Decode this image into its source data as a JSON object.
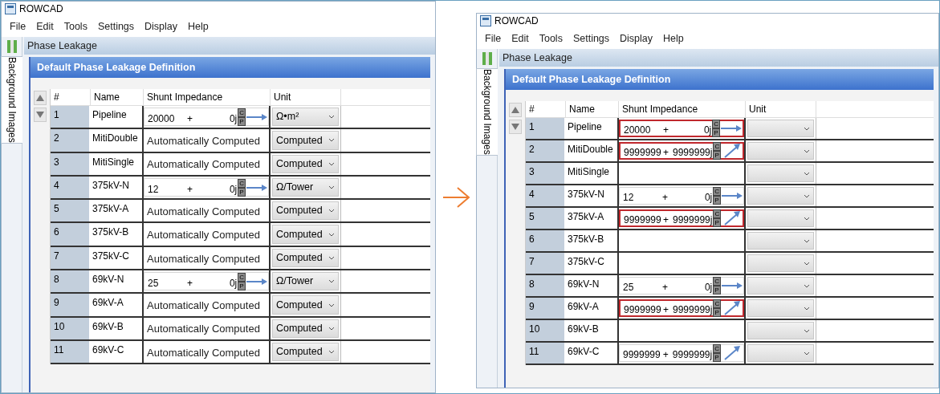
{
  "panels": [
    {
      "window": {
        "title": "ROWCAD"
      },
      "menu": [
        "File",
        "Edit",
        "Tools",
        "Settings",
        "Display",
        "Help"
      ],
      "side_tab": "Background Images",
      "panel_title": "Phase Leakage",
      "dialog_title": "Default Phase Leakage Definition",
      "table": {
        "columns": [
          "#",
          "Name",
          "Shunt Impedance",
          "Unit"
        ],
        "rows": [
          {
            "number": "1",
            "name": "Pipeline",
            "impedance": {
              "kind": "complex",
              "real": "20000",
              "sign": "+",
              "imag": "0j",
              "toggle": [
                "C",
                "P"
              ],
              "arrow": {
                "kind": "flat"
              },
              "error": false
            },
            "unit": "Ω•m²"
          },
          {
            "number": "2",
            "name": "MitiDouble",
            "impedance": {
              "kind": "computed",
              "text": "Automatically Computed"
            },
            "unit": "Computed"
          },
          {
            "number": "3",
            "name": "MitiSingle",
            "impedance": {
              "kind": "computed",
              "text": "Automatically Computed"
            },
            "unit": "Computed"
          },
          {
            "number": "4",
            "name": "375kV-N",
            "impedance": {
              "kind": "complex",
              "real": "12",
              "sign": "+",
              "imag": "0j",
              "toggle": [
                "C",
                "P"
              ],
              "arrow": {
                "kind": "flat"
              },
              "error": false
            },
            "unit": "Ω/Tower"
          },
          {
            "number": "5",
            "name": "375kV-A",
            "impedance": {
              "kind": "computed",
              "text": "Automatically Computed"
            },
            "unit": "Computed"
          },
          {
            "number": "6",
            "name": "375kV-B",
            "impedance": {
              "kind": "computed",
              "text": "Automatically Computed"
            },
            "unit": "Computed"
          },
          {
            "number": "7",
            "name": "375kV-C",
            "impedance": {
              "kind": "computed",
              "text": "Automatically Computed"
            },
            "unit": "Computed"
          },
          {
            "number": "8",
            "name": "69kV-N",
            "impedance": {
              "kind": "complex",
              "real": "25",
              "sign": "+",
              "imag": "0j",
              "toggle": [
                "C",
                "P"
              ],
              "arrow": {
                "kind": "flat"
              },
              "error": false
            },
            "unit": "Ω/Tower"
          },
          {
            "number": "9",
            "name": "69kV-A",
            "impedance": {
              "kind": "computed",
              "text": "Automatically Computed"
            },
            "unit": "Computed"
          },
          {
            "number": "10",
            "name": "69kV-B",
            "impedance": {
              "kind": "computed",
              "text": "Automatically Computed"
            },
            "unit": "Computed"
          },
          {
            "number": "11",
            "name": "69kV-C",
            "impedance": {
              "kind": "computed",
              "text": "Automatically Computed"
            },
            "unit": "Computed"
          }
        ]
      }
    },
    {
      "window": {
        "title": "ROWCAD"
      },
      "menu": [
        "File",
        "Edit",
        "Tools",
        "Settings",
        "Display",
        "Help"
      ],
      "side_tab": "Background Images",
      "panel_title": "Phase Leakage",
      "dialog_title": "Default Phase Leakage Definition",
      "table": {
        "columns": [
          "#",
          "Name",
          "Shunt Impedance",
          "Unit"
        ],
        "rows": [
          {
            "number": "1",
            "name": "Pipeline",
            "impedance": {
              "kind": "complex",
              "real": "20000",
              "sign": "+",
              "imag": "0j",
              "toggle": [
                "C",
                "P"
              ],
              "arrow": {
                "kind": "flat"
              },
              "error": true
            }
          },
          {
            "number": "2",
            "name": "MitiDouble",
            "impedance": {
              "kind": "complex",
              "real": "9999999",
              "sign": "+",
              "imag": "9999999j",
              "toggle": [
                "C",
                "P"
              ],
              "arrow": {
                "kind": "diagonal"
              },
              "error": true
            }
          },
          {
            "number": "3",
            "name": "MitiSingle",
            "impedance": {
              "kind": "empty"
            }
          },
          {
            "number": "4",
            "name": "375kV-N",
            "impedance": {
              "kind": "complex",
              "real": "12",
              "sign": "+",
              "imag": "0j",
              "toggle": [
                "C",
                "P"
              ],
              "arrow": {
                "kind": "flat"
              },
              "error": false
            }
          },
          {
            "number": "5",
            "name": "375kV-A",
            "impedance": {
              "kind": "complex",
              "real": "9999999",
              "sign": "+",
              "imag": "9999999j",
              "toggle": [
                "C",
                "P"
              ],
              "arrow": {
                "kind": "diagonal"
              },
              "error": true
            }
          },
          {
            "number": "6",
            "name": "375kV-B",
            "impedance": {
              "kind": "empty"
            }
          },
          {
            "number": "7",
            "name": "375kV-C",
            "impedance": {
              "kind": "empty"
            }
          },
          {
            "number": "8",
            "name": "69kV-N",
            "impedance": {
              "kind": "complex",
              "real": "25",
              "sign": "+",
              "imag": "0j",
              "toggle": [
                "C",
                "P"
              ],
              "arrow": {
                "kind": "flat"
              },
              "error": false
            }
          },
          {
            "number": "9",
            "name": "69kV-A",
            "impedance": {
              "kind": "complex",
              "real": "9999999",
              "sign": "+",
              "imag": "9999999j",
              "toggle": [
                "C",
                "P"
              ],
              "arrow": {
                "kind": "diagonal"
              },
              "error": true
            }
          },
          {
            "number": "10",
            "name": "69kV-B",
            "impedance": {
              "kind": "empty"
            }
          },
          {
            "number": "11",
            "name": "69kV-C",
            "impedance": {
              "kind": "complex",
              "real": "9999999",
              "sign": "+",
              "imag": "9999999j",
              "toggle": [
                "C",
                "P"
              ],
              "arrow": {
                "kind": "diagonal"
              },
              "error": false
            }
          }
        ]
      }
    }
  ]
}
